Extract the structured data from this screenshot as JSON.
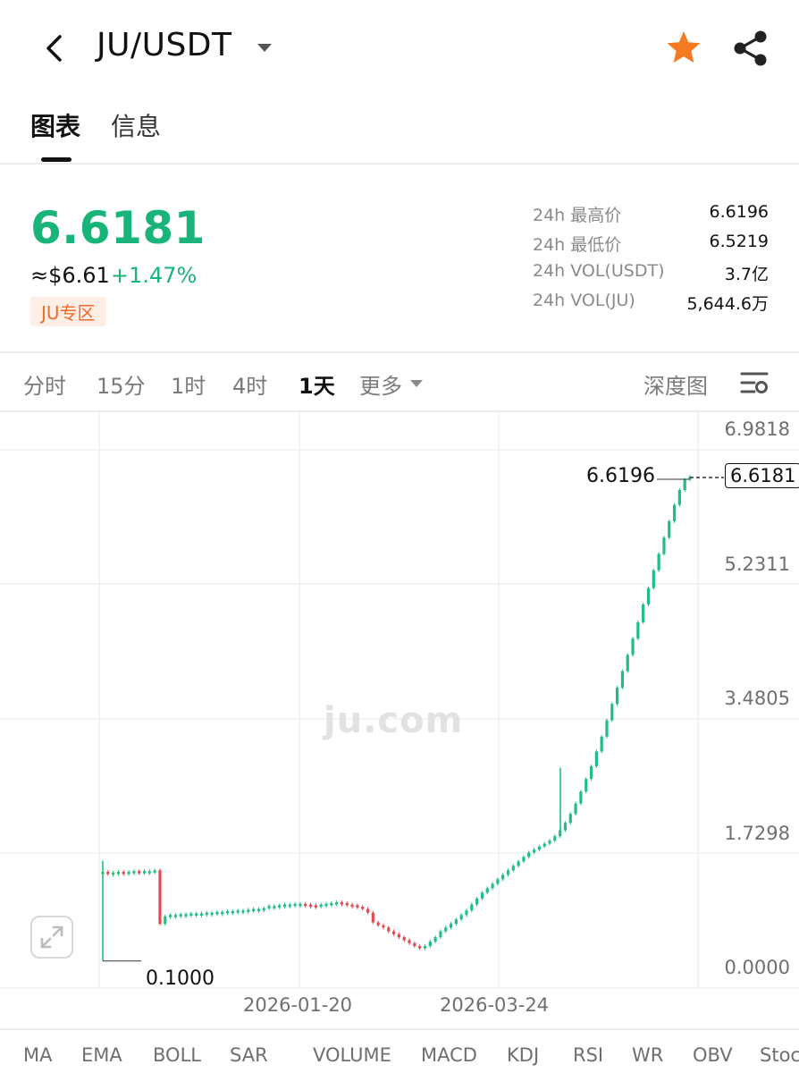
{
  "header": {
    "pair": "JU/USDT",
    "tabs": [
      {
        "label": "图表",
        "active": true
      },
      {
        "label": "信息",
        "active": false
      }
    ]
  },
  "ticker": {
    "price": "6.6181",
    "usd_price": "≈$6.61",
    "change_pct": "+1.47%",
    "zone_badge": "JU专区",
    "stats": [
      {
        "label": "24h 最高价",
        "value": "6.6196"
      },
      {
        "label": "24h 最低价",
        "value": "6.5219"
      },
      {
        "label": "24h VOL(USDT)",
        "value": "3.7亿"
      },
      {
        "label": "24h VOL(JU)",
        "value": "5,644.6万"
      }
    ]
  },
  "timeframes": {
    "items": [
      "分时",
      "15分",
      "1时",
      "4时",
      "1天",
      "更多"
    ],
    "active": "1天",
    "depth_label": "深度图"
  },
  "chart_data": {
    "type": "candlestick",
    "watermark": "ju.com",
    "y_ticks": [
      "6.9818",
      "5.2311",
      "3.4805",
      "1.7298",
      "0.0000"
    ],
    "x_ticks": [
      "2026-01-20",
      "2026-03-24"
    ],
    "ylim": [
      0.0,
      6.9818
    ],
    "high_marker": "6.6196",
    "low_marker": "0.1000",
    "current_price": "6.6181",
    "colors": {
      "up": "#1fbf83",
      "down": "#e5484d"
    },
    "series_close_approx": [
      1.3,
      1.28,
      1.29,
      1.3,
      1.29,
      1.3,
      1.31,
      1.3,
      1.31,
      1.31,
      1.32,
      0.6,
      0.7,
      0.72,
      0.72,
      0.73,
      0.73,
      0.74,
      0.74,
      0.74,
      0.75,
      0.75,
      0.76,
      0.76,
      0.77,
      0.77,
      0.78,
      0.78,
      0.79,
      0.8,
      0.8,
      0.81,
      0.84,
      0.84,
      0.85,
      0.86,
      0.86,
      0.87,
      0.87,
      0.86,
      0.85,
      0.84,
      0.86,
      0.87,
      0.88,
      0.89,
      0.88,
      0.86,
      0.85,
      0.83,
      0.8,
      0.75,
      0.62,
      0.58,
      0.55,
      0.5,
      0.46,
      0.42,
      0.38,
      0.34,
      0.3,
      0.28,
      0.3,
      0.36,
      0.42,
      0.5,
      0.55,
      0.6,
      0.66,
      0.72,
      0.78,
      0.86,
      0.94,
      1.02,
      1.08,
      1.14,
      1.2,
      1.26,
      1.32,
      1.38,
      1.44,
      1.5,
      1.56,
      1.6,
      1.64,
      1.68,
      1.72,
      1.78,
      1.86,
      1.96,
      2.08,
      2.22,
      2.38,
      2.55,
      2.72,
      2.92,
      3.12,
      3.34,
      3.56,
      3.78,
      4.0,
      4.22,
      4.44,
      4.66,
      4.9,
      5.12,
      5.36,
      5.58,
      5.8,
      6.02,
      6.24,
      6.44,
      6.58,
      6.62
    ]
  },
  "indicators": [
    "MA",
    "EMA",
    "BOLL",
    "SAR",
    "VOLUME",
    "MACD",
    "KDJ",
    "RSI",
    "WR",
    "OBV",
    "Stoc"
  ]
}
